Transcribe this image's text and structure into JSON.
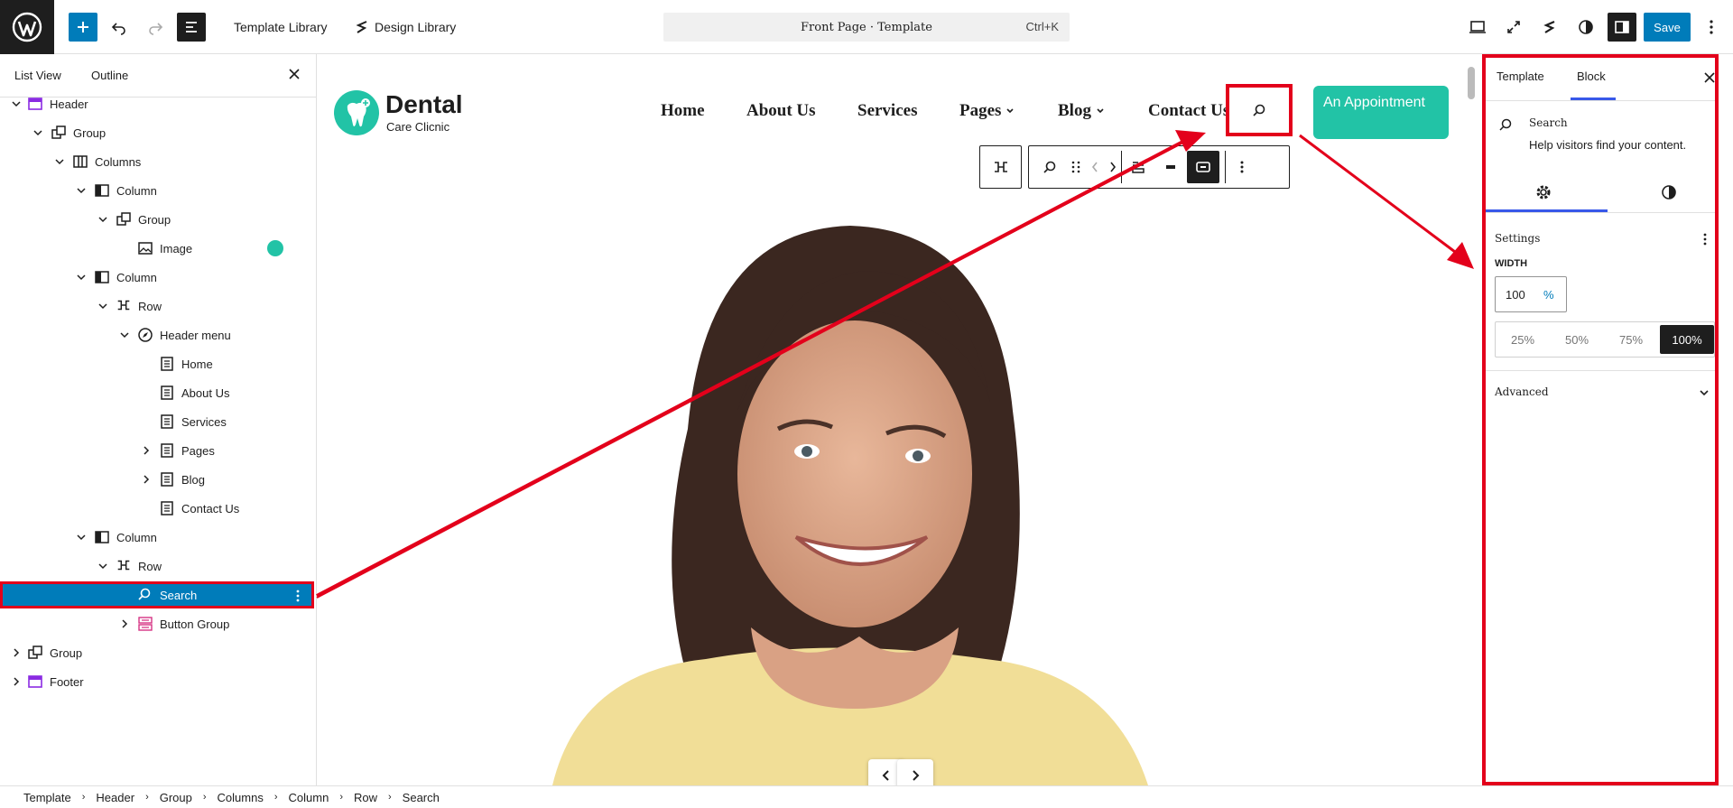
{
  "topbar": {
    "template_library": "Template Library",
    "design_library": "Design Library",
    "command_title": "Front Page · Template",
    "command_shortcut": "Ctrl+K",
    "save_label": "Save"
  },
  "left_panel": {
    "tabs": [
      "List View",
      "Outline"
    ],
    "tree": [
      {
        "label": "Header",
        "icon": "template-part-icon"
      },
      {
        "label": "Group",
        "icon": "group-icon"
      },
      {
        "label": "Columns",
        "icon": "columns-icon"
      },
      {
        "label": "Column",
        "icon": "column-icon"
      },
      {
        "label": "Group",
        "icon": "group-icon"
      },
      {
        "label": "Image",
        "icon": "image-icon"
      },
      {
        "label": "Column",
        "icon": "column-icon"
      },
      {
        "label": "Row",
        "icon": "row-icon"
      },
      {
        "label": "Header menu",
        "icon": "navigation-icon"
      },
      {
        "label": "Home",
        "icon": "page-icon"
      },
      {
        "label": "About Us",
        "icon": "page-icon"
      },
      {
        "label": "Services",
        "icon": "page-icon"
      },
      {
        "label": "Pages",
        "icon": "page-icon"
      },
      {
        "label": "Blog",
        "icon": "page-icon"
      },
      {
        "label": "Contact Us",
        "icon": "page-icon"
      },
      {
        "label": "Column",
        "icon": "column-icon"
      },
      {
        "label": "Row",
        "icon": "row-icon"
      },
      {
        "label": "Search",
        "icon": "search-icon"
      },
      {
        "label": "Button Group",
        "icon": "buttons-icon"
      },
      {
        "label": "Group",
        "icon": "group-icon"
      },
      {
        "label": "Footer",
        "icon": "template-part-icon"
      }
    ]
  },
  "breadcrumb": [
    "Template",
    "Header",
    "Group",
    "Columns",
    "Column",
    "Row",
    "Search"
  ],
  "canvas": {
    "logo_title": "Dental",
    "logo_subtitle": "Care Clicnic",
    "nav": [
      "Home",
      "About Us",
      "Services",
      "Pages",
      "Blog",
      "Contact Us"
    ],
    "appointment_label": "An Appointment"
  },
  "right_panel": {
    "tabs": [
      "Template",
      "Block"
    ],
    "block_name": "Search",
    "block_description": "Help visitors find your content.",
    "settings_label": "Settings",
    "width_label": "WIDTH",
    "width_value": "100",
    "width_unit": "%",
    "width_presets": [
      "25%",
      "50%",
      "75%",
      "100%"
    ],
    "advanced_label": "Advanced"
  },
  "colors": {
    "accent": "#007cba",
    "brand_teal": "#22c3a6",
    "annotation_red": "#e3001b"
  }
}
